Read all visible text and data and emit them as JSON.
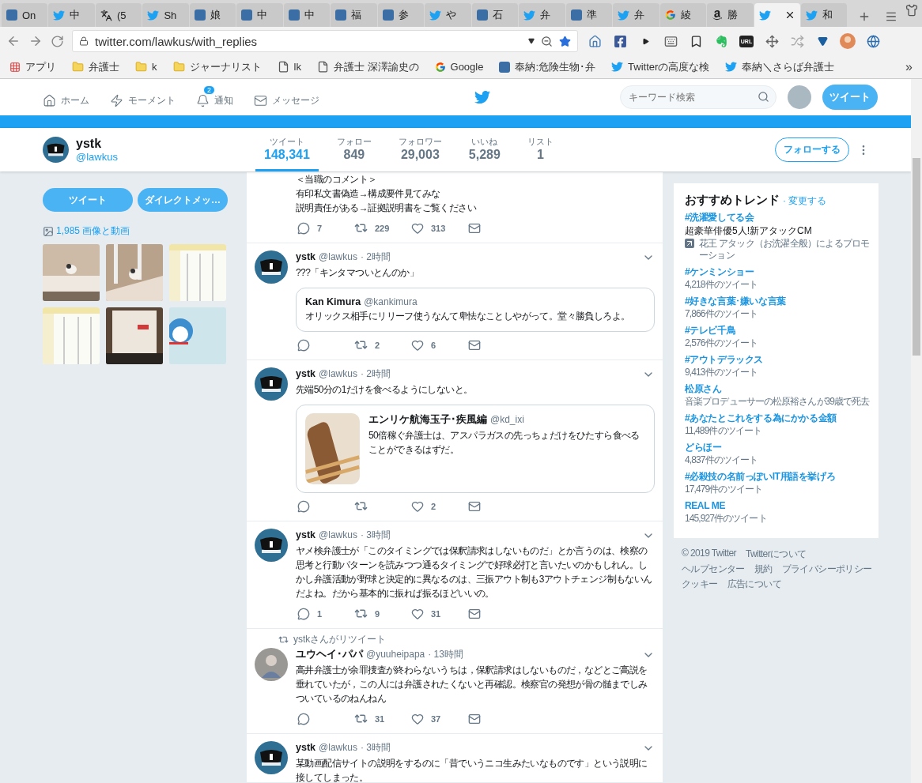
{
  "browser": {
    "tabs": [
      {
        "label": "On",
        "selected": false
      },
      {
        "label": "中",
        "selected": false
      },
      {
        "label": "(5",
        "selected": false
      },
      {
        "label": "Sh",
        "selected": false
      },
      {
        "label": "娘",
        "selected": false
      },
      {
        "label": "中",
        "selected": false
      },
      {
        "label": "中",
        "selected": false
      },
      {
        "label": "福",
        "selected": false
      },
      {
        "label": "参",
        "selected": false
      },
      {
        "label": "や",
        "selected": false
      },
      {
        "label": "石",
        "selected": false
      },
      {
        "label": "弁",
        "selected": false
      },
      {
        "label": "準",
        "selected": false
      },
      {
        "label": "弁",
        "selected": false
      },
      {
        "label": "綾",
        "selected": false
      },
      {
        "label": "勝",
        "selected": false
      },
      {
        "selected": true
      },
      {
        "label": "和",
        "selected": false
      }
    ],
    "address": "twitter.com/lawkus/with_replies",
    "url_extension": "URL",
    "bookmarks": [
      "アプリ",
      "弁護士",
      "k",
      "ジャーナリスト",
      "lk",
      "弁護士 深澤諭史の",
      "Google",
      "奉納:危険生物･弁",
      "Twitterの高度な検",
      "奉納＼さらば弁護士"
    ],
    "bookmarks_overflow": "»"
  },
  "nav": {
    "items": [
      {
        "label": "ホーム"
      },
      {
        "label": "モーメント"
      },
      {
        "label": "通知",
        "badge": "2"
      },
      {
        "label": "メッセージ"
      }
    ],
    "search_placeholder": "キーワード検索",
    "tweet_button": "ツイート"
  },
  "profile": {
    "name": "ystk",
    "handle": "@lawkus",
    "stats": [
      {
        "label": "ツイート",
        "value": "148,341",
        "selected": true
      },
      {
        "label": "フォロー",
        "value": "849",
        "selected": false
      },
      {
        "label": "フォロワー",
        "value": "29,003",
        "selected": false
      },
      {
        "label": "いいね",
        "value": "5,289",
        "selected": false
      },
      {
        "label": "リスト",
        "value": "1",
        "selected": false
      }
    ],
    "follow_button": "フォローする"
  },
  "sidebar": {
    "buttons": [
      "ツイート",
      "ダイレクトメッ…"
    ],
    "media_link": "1,985 画像と動画",
    "media": [
      {
        "kind": "picture"
      },
      {
        "kind": "picture"
      },
      {
        "kind": "picture"
      },
      {
        "kind": "picture"
      },
      {
        "kind": "picture"
      },
      {
        "kind": "picture"
      }
    ]
  },
  "timeline": [
    {
      "kind": "partial",
      "lines": [
        "＜当職のコメント＞",
        "有印私文書偽造→構成要件見てみな",
        "説明責任がある→証拠説明書をご覧ください"
      ],
      "replies": "7",
      "retweets": "229",
      "likes": "313"
    },
    {
      "kind": "tweet",
      "name": "ystk",
      "handle": "@lawkus",
      "time": "· 2時間",
      "text": "???「キンタマついとんのか」",
      "quote": {
        "name": "Kan Kimura",
        "handle": "@kankimura",
        "text": "オリックス相手にリリーフ使うなんて卑怯なことしやがって。堂々勝負しろよ。"
      },
      "retweets": "2",
      "likes": "6"
    },
    {
      "kind": "tweet",
      "name": "ystk",
      "handle": "@lawkus",
      "time": "· 2時間",
      "text": "先端50分の1だけを食べるようにしないと。",
      "quote": {
        "name": "エンリケ航海玉子･疾風編",
        "handle": "@kd_ixi",
        "text": "50倍稼ぐ弁護士は、アスパラガスの先っちょだけをひたすら食べることができるはずだ。",
        "media": {
          "kind": "picture"
        }
      },
      "likes": "2"
    },
    {
      "kind": "tweet",
      "name": "ystk",
      "handle": "@lawkus",
      "time": "· 3時間",
      "text": "ヤメ検弁護士が「このタイミングでは保釈請求はしないものだ」とか言うのは、検察の思考と行動パターンを読みつつ通るタイミングで好球必打と言いたいのかもしれん。しかし弁護活動が野球と決定的に異なるのは、三振アウト制も3アウトチェンジ制もないんだよね。だから基本的に振れば振るほどいいの。",
      "replies": "1",
      "retweets": "9",
      "likes": "31"
    },
    {
      "kind": "retweet",
      "retweeted_by": "ystkさんがリツイート",
      "name": "ユウヘイ･パパ",
      "handle": "@yuuheipapa",
      "time": "· 13時間",
      "text": "高井弁護士が余罪捜査が終わらないうちは，保釈請求はしないものだ，などとご高説を垂れていたが，この人には弁護されたくないと再確認。検察官の発想が骨の髄までしみついているのねんねん",
      "retweets": "31",
      "likes": "37"
    },
    {
      "kind": "tweet",
      "name": "ystk",
      "handle": "@lawkus",
      "time": "· 3時間",
      "text": "某動画配信サイトの説明をするのに「昔でいうニコ生みたいなものです」という説明に接してしまった。"
    }
  ],
  "trends": {
    "title": "おすすめトレンド",
    "change_link": "· 変更する",
    "items": [
      {
        "name": "#洗濯愛してる会",
        "description": "超豪華俳優5人!新アタックCM",
        "promoted": "花王 アタック（お洗濯全般）によるプロモーション"
      },
      {
        "name": "#ケンミンショー",
        "meta": "4,218件のツイート"
      },
      {
        "name": "#好きな言葉･嫌いな言葉",
        "meta": "7,866件のツイート"
      },
      {
        "name": "#テレビ千鳥",
        "meta": "2,576件のツイート"
      },
      {
        "name": "#アウトデラックス",
        "meta": "9,413件のツイート"
      },
      {
        "name": "松原さん",
        "meta": "音楽プロデューサーの松原裕さんが39歳で死去"
      },
      {
        "name": "#あなたとこれをする為にかかる金額",
        "meta": "11,489件のツイート"
      },
      {
        "name": "どらほー",
        "meta": "4,837件のツイート"
      },
      {
        "name": "#必殺技の名前っぽいIT用語を挙げろ",
        "meta": "17,479件のツイート"
      },
      {
        "name": "REAL ME",
        "meta": "145,927件のツイート"
      }
    ]
  },
  "footer": [
    [
      "© 2019 Twitter",
      "Twitterについて"
    ],
    [
      "ヘルプセンター",
      "規約",
      "プライバシーポリシー"
    ],
    [
      "クッキー",
      "広告について"
    ]
  ]
}
